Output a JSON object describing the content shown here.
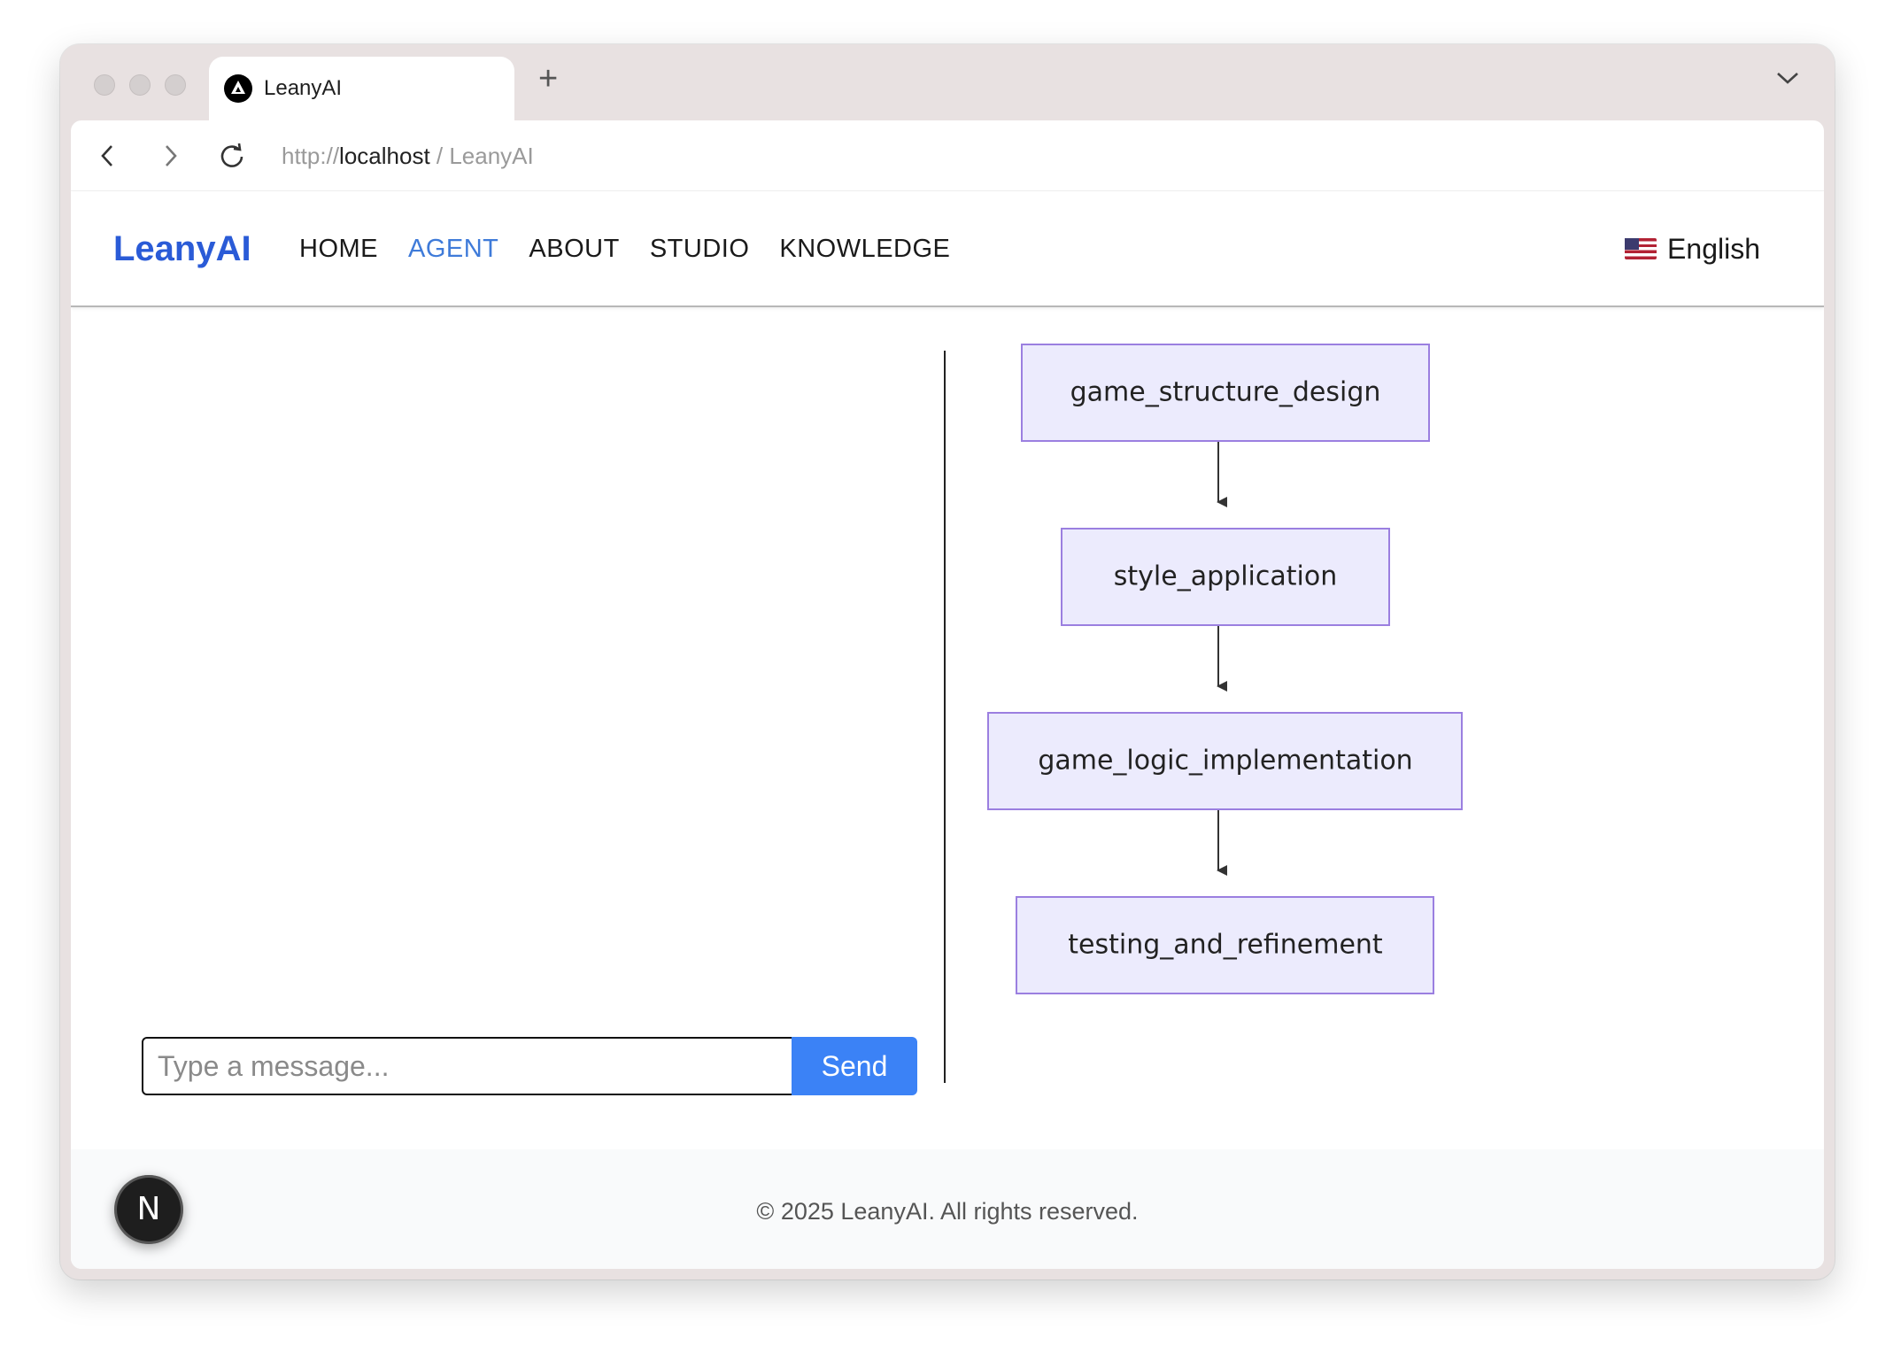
{
  "browser": {
    "tab_title": "LeanyAI",
    "new_tab_label": "+",
    "url_scheme": "http://",
    "url_host": "localhost",
    "url_path": " / LeanyAI"
  },
  "site": {
    "brand": "LeanyAI",
    "nav": [
      {
        "label": "HOME"
      },
      {
        "label": "AGENT",
        "active": true
      },
      {
        "label": "ABOUT"
      },
      {
        "label": "STUDIO"
      },
      {
        "label": "KNOWLEDGE"
      }
    ],
    "language": "English",
    "language_flag": "us-flag"
  },
  "chat": {
    "placeholder": "Type a message...",
    "send_label": "Send"
  },
  "workflow": {
    "nodes": [
      {
        "label": "game_structure_design"
      },
      {
        "label": "style_application"
      },
      {
        "label": "game_logic_implementation"
      },
      {
        "label": "testing_and_refinement"
      }
    ]
  },
  "footer": {
    "copyright": "© 2025 LeanyAI. All rights reserved."
  },
  "dev_badge": "N",
  "colors": {
    "brand": "#2a5bd7",
    "active_nav": "#3f7bd9",
    "send_button": "#3b82f6",
    "node_fill": "#ecebfd",
    "node_stroke": "#9b7fe0"
  }
}
